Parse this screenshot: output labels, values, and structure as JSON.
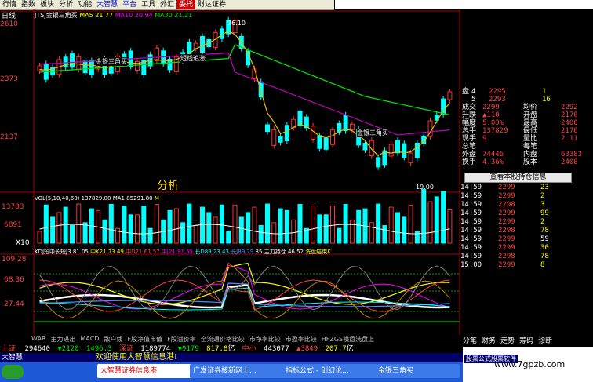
{
  "menu": [
    "行情",
    "指数",
    "板块",
    "分析",
    "功能",
    "大智慧",
    "平台",
    "工具",
    "外汇",
    "委托",
    "财达证券"
  ],
  "period_tab": "日线",
  "price_header": {
    "code": "JTSJ",
    "name": "金银三角买",
    "ma5": "MA5 21.77",
    "ma10": "MA10 20.94",
    "ma30": "MA30 21.21"
  },
  "price_axis": [
    "2610",
    "2373",
    "2137"
  ],
  "high_label": "26.10",
  "low_label": "19.00",
  "annotations": [
    "金银三角买",
    "短线追涨",
    "金银三角买"
  ],
  "watermark": "分析",
  "volume_header": {
    "label": "VOL(5,10,40,60)",
    "vol": "137829.00",
    "ma1": "MA1 85291.80",
    "ma2": "M"
  },
  "volume_axis": [
    "13783",
    "6891",
    "X10"
  ],
  "kdj_header": {
    "label": "KDJ短中长短J3",
    "a": "81.05",
    "b": "中K21 73.49",
    "c": "中D21 61.57",
    "d": "中J21 91.55",
    "e": "长D89 23.43",
    "f": "长D89 23.43",
    "g": "长J89",
    "h": "29",
    "i": "85",
    "j": "主力持仓",
    "k": "46.52",
    "l": "洗盘结束K"
  },
  "kdj_axis": [
    "109.28",
    "68.36",
    "27.44"
  ],
  "quote": {
    "rows": [
      {
        "l": "盘",
        "sub": "4",
        "v": "2295",
        "n": "1"
      },
      {
        "l": "",
        "sub": "5",
        "v": "2293",
        "n": "16"
      }
    ],
    "stats": [
      {
        "l": "成交",
        "v": "2299",
        "l2": "均价",
        "v2": "2292"
      },
      {
        "l": "升跌",
        "v": "▲110",
        "l2": "开盘",
        "v2": "2170"
      },
      {
        "l": "幅度",
        "v": "5.03%",
        "l2": "最高",
        "v2": "2400"
      },
      {
        "l": "总手",
        "v": "137829",
        "l2": "最低",
        "v2": "2170"
      },
      {
        "l": "现手",
        "v": "9",
        "l2": "量比",
        "v2": "2.11"
      },
      {
        "l": "总笔",
        "v": "",
        "l2": "每笔",
        "v2": ""
      },
      {
        "l": "外盘",
        "v": "74446",
        "l2": "内盘",
        "v2": "63383"
      },
      {
        "l": "换手",
        "v": "4.36%",
        "l2": "股本",
        "v2": "2408"
      }
    ]
  },
  "hold_button": "查看本股持仓信息",
  "ticks": [
    {
      "t": "14:59",
      "p": "2299",
      "v": "23"
    },
    {
      "t": "14:59",
      "p": "2299",
      "v": "2"
    },
    {
      "t": "14:59",
      "p": "2298",
      "v": "3"
    },
    {
      "t": "14:59",
      "p": "2299",
      "v": "99"
    },
    {
      "t": "14:59",
      "p": "2299",
      "v": "2"
    },
    {
      "t": "14:59",
      "p": "2298",
      "v": "78"
    },
    {
      "t": "14:59",
      "p": "2299",
      "v": "59"
    },
    {
      "t": "14:59",
      "p": "2299",
      "v": "30"
    },
    {
      "t": "14:59",
      "p": "2298",
      "v": "78"
    },
    {
      "t": "15:00",
      "p": "2299",
      "v": "8"
    }
  ],
  "function_tabs": [
    "WAR",
    "主力进出",
    "MACD",
    "散户线",
    "F股净值市值",
    "F股溢价率",
    "全流通价格比较",
    "市净率比较",
    "市盈率比较",
    "HFZGS横盘洗盘上"
  ],
  "right_tabs": [
    "分笔",
    "财务",
    "走势",
    "筹码",
    "诊断"
  ],
  "status": {
    "sh": "上证",
    "sh_v": "294640",
    "sh_chg": "▼2120",
    "sh_idx": "1496.3",
    "sz": "深证",
    "sz_v": "1189774",
    "sz_chg": "▼9179",
    "sz_idx": "817.8",
    "sz_unit": "亿",
    "mid": "中小",
    "mid_v": "443077",
    "mid_chg": "▲3849",
    "mid_idx": "207.7",
    "mid_unit": "亿"
  },
  "message": "欢迎使用大智慧信息港!",
  "brand": "大智慧",
  "taskbar": [
    "大智慧证券信息港",
    "广发证券核新网上...",
    "指标公式 - 剑幻论...",
    "金银三角买"
  ],
  "footer_url": "www.7gpzb.com",
  "right_edge_text": "股票公式股票软件"
}
